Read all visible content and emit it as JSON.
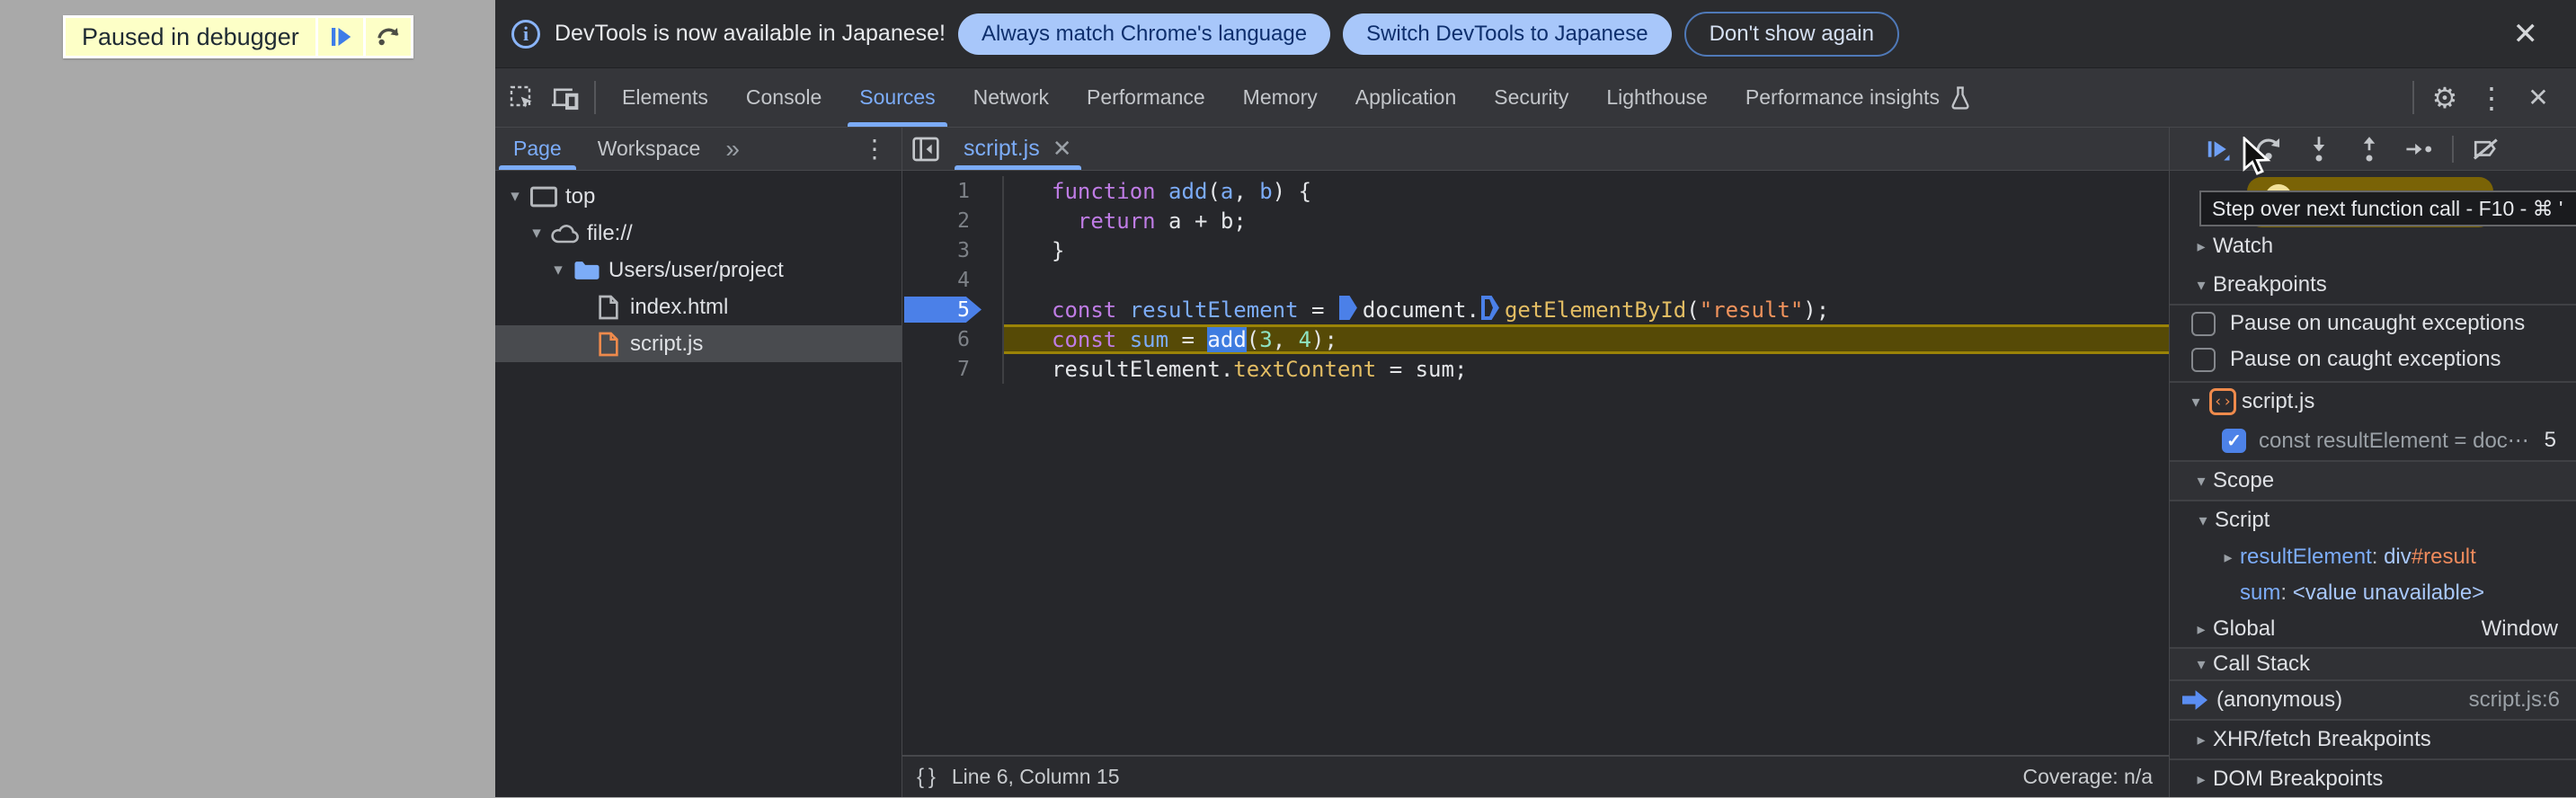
{
  "colors": {
    "accent": "#7cacf8",
    "breakpoint_blue": "#4b80e8",
    "paused_line_gold": "#564a06",
    "pill_blue": "#a8c7fa",
    "ribbon_yellow": "#fdffc7"
  },
  "page": {
    "paused_ribbon": {
      "label": "Paused in debugger"
    }
  },
  "infobar": {
    "message": "DevTools is now available in Japanese!",
    "actions": [
      {
        "label": "Always match Chrome's language",
        "style": "filled"
      },
      {
        "label": "Switch DevTools to Japanese",
        "style": "filled"
      },
      {
        "label": "Don't show again",
        "style": "outlined"
      }
    ]
  },
  "toolbar": {
    "tabs": [
      {
        "label": "Elements"
      },
      {
        "label": "Console"
      },
      {
        "label": "Sources",
        "selected": true
      },
      {
        "label": "Network"
      },
      {
        "label": "Performance"
      },
      {
        "label": "Memory"
      },
      {
        "label": "Application"
      },
      {
        "label": "Security"
      },
      {
        "label": "Lighthouse"
      },
      {
        "label": "Performance insights",
        "icon": "flask"
      }
    ]
  },
  "navigator": {
    "tabs": [
      {
        "label": "Page"
      },
      {
        "label": "Workspace"
      }
    ],
    "selected_tab": "Page",
    "tree": [
      {
        "label": "top",
        "depth": 0,
        "icon": "frame",
        "expanded": true
      },
      {
        "label": "file://",
        "depth": 1,
        "icon": "cloud",
        "expanded": true
      },
      {
        "label": "Users/user/project",
        "depth": 2,
        "icon": "folder",
        "expanded": true
      },
      {
        "label": "index.html",
        "depth": 3,
        "icon": "file"
      },
      {
        "label": "script.js",
        "depth": 3,
        "icon": "file-js",
        "selected": true
      }
    ]
  },
  "editor": {
    "tab": {
      "label": "script.js"
    },
    "lines": [
      {
        "num": "1",
        "tokens": [
          [
            "kw",
            "function"
          ],
          [
            "pl",
            " "
          ],
          [
            "df",
            "add"
          ],
          [
            "pl",
            "("
          ],
          [
            "df",
            "a"
          ],
          [
            "pl",
            ", "
          ],
          [
            "df",
            "b"
          ],
          [
            "pl",
            ") {"
          ]
        ]
      },
      {
        "num": "2",
        "tokens": [
          [
            "pl",
            "  "
          ],
          [
            "kw",
            "return"
          ],
          [
            "pl",
            " a + b;"
          ]
        ]
      },
      {
        "num": "3",
        "tokens": [
          [
            "pl",
            "}"
          ]
        ]
      },
      {
        "num": "4",
        "tokens": []
      },
      {
        "num": "5",
        "breakpoint": true,
        "tokens": [
          [
            "kw",
            "const"
          ],
          [
            "pl",
            " "
          ],
          [
            "df",
            "resultElement"
          ],
          [
            "pl",
            " = "
          ],
          [
            "mkf",
            ""
          ],
          [
            "pl",
            "document."
          ],
          [
            "mko",
            ""
          ],
          [
            "pr",
            "getElementById"
          ],
          [
            "pl",
            "("
          ],
          [
            "st",
            "\"result\""
          ],
          [
            "pl",
            ");"
          ]
        ]
      },
      {
        "num": "6",
        "paused": true,
        "tokens": [
          [
            "kw",
            "const"
          ],
          [
            "pl",
            " "
          ],
          [
            "df",
            "sum"
          ],
          [
            "pl",
            " = "
          ],
          [
            "sel",
            "add"
          ],
          [
            "pl",
            "("
          ],
          [
            "nu",
            "3"
          ],
          [
            "pl",
            ", "
          ],
          [
            "nu",
            "4"
          ],
          [
            "pl",
            ");"
          ]
        ]
      },
      {
        "num": "7",
        "tokens": [
          [
            "pl",
            "resultElement."
          ],
          [
            "pr",
            "textContent"
          ],
          [
            "pl",
            " = sum;"
          ]
        ]
      }
    ],
    "status": {
      "position": "Line 6, Column 15",
      "coverage": "Coverage: n/a"
    }
  },
  "debugger": {
    "tooltip": "Step over next function call - F10 - ⌘ '",
    "watch_label": "Watch",
    "breakpoints": {
      "label": "Breakpoints",
      "pause_uncaught": "Pause on uncaught exceptions",
      "pause_caught": "Pause on caught exceptions",
      "file": "script.js",
      "entry": {
        "label": "const resultElement = doc⋯",
        "line": "5"
      }
    },
    "scope": {
      "label": "Scope",
      "script_label": "Script",
      "var1": {
        "name": "resultElement",
        "sep": ": ",
        "tag": "div",
        "id": "#result"
      },
      "var2": {
        "name": "sum",
        "sep": ": ",
        "value": "<value unavailable>"
      },
      "global": {
        "label": "Global",
        "value": "Window"
      }
    },
    "call_stack": {
      "label": "Call Stack",
      "frames": [
        {
          "name": "(anonymous)",
          "location": "script.js:6"
        }
      ]
    },
    "xhr_label": "XHR/fetch Breakpoints",
    "dom_label": "DOM Breakpoints"
  }
}
